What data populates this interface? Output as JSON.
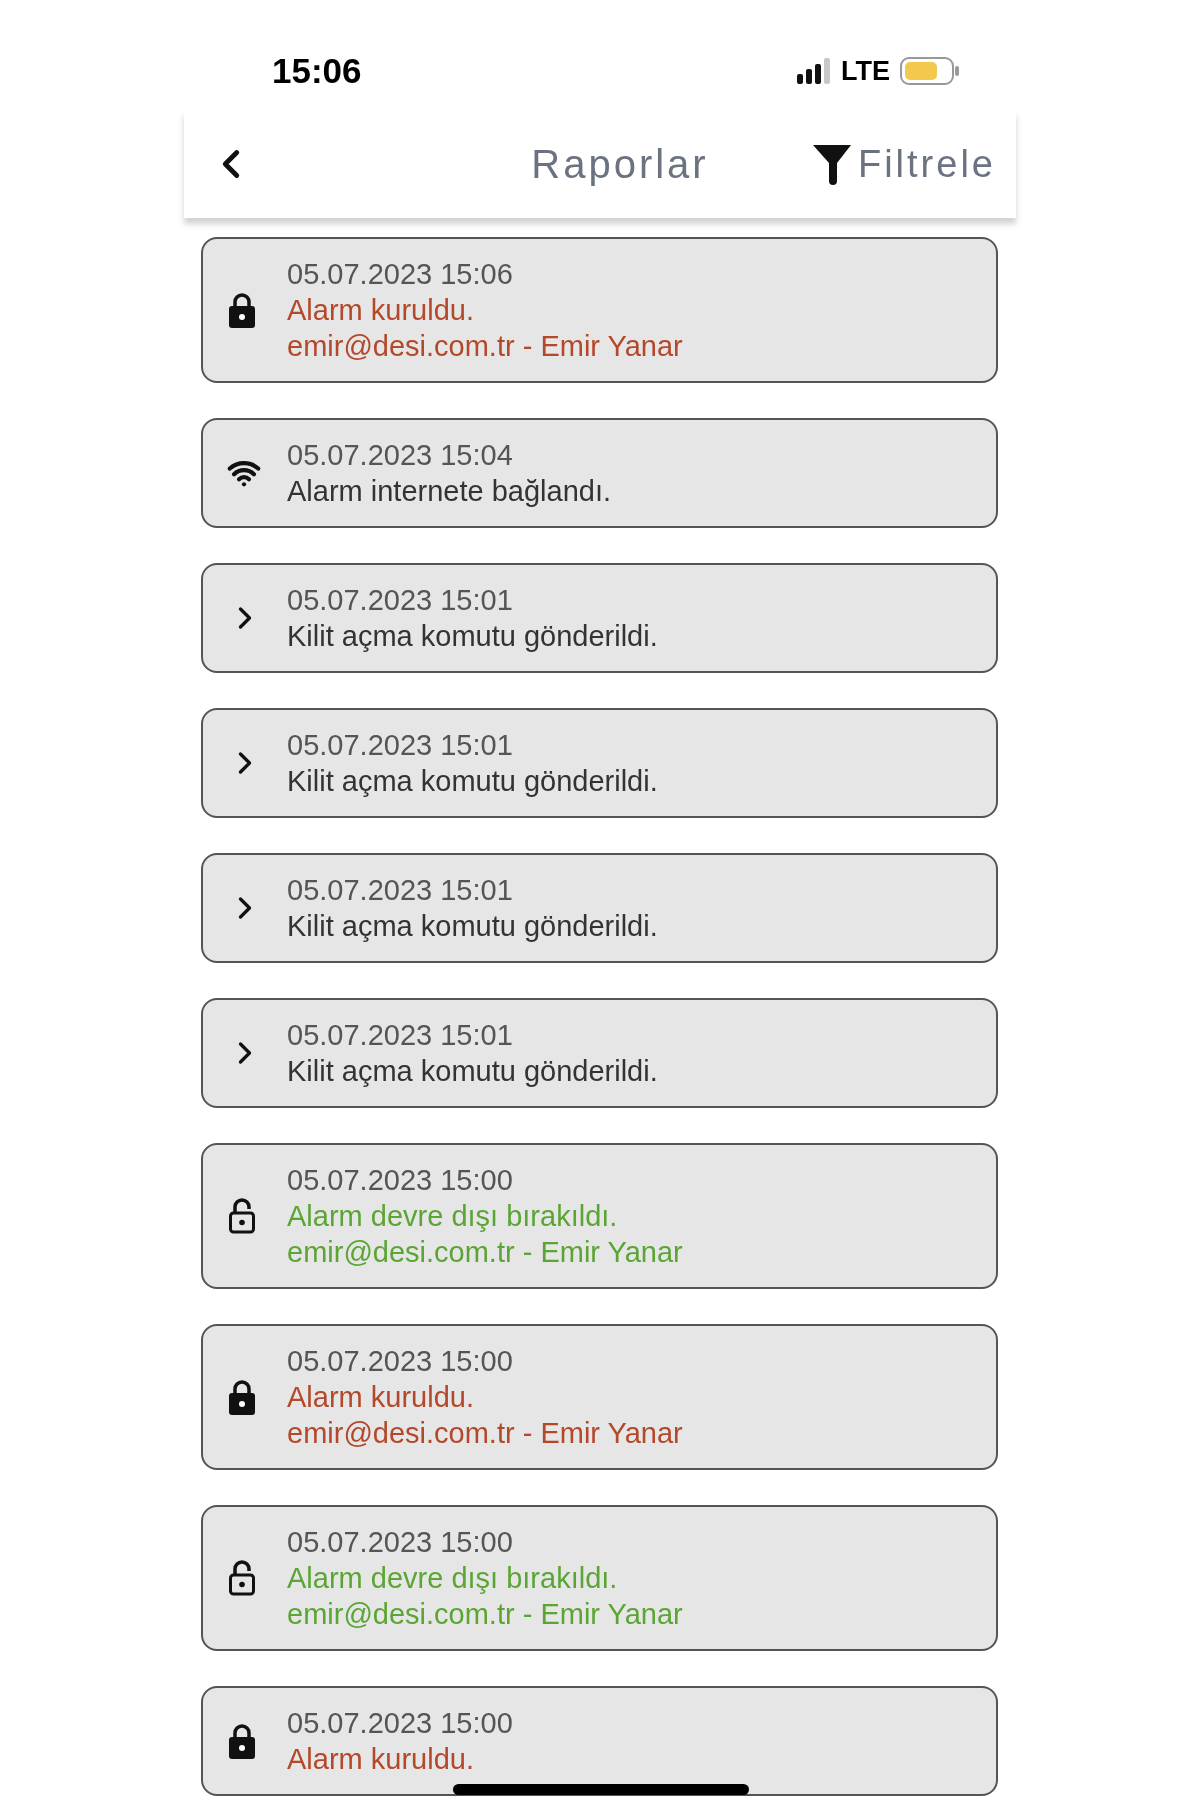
{
  "status_bar": {
    "time": "15:06",
    "network": "LTE"
  },
  "header": {
    "title": "Raporlar",
    "filter": "Filtrele"
  },
  "reports": [
    {
      "kind": "armed",
      "datetime": "05.07.2023 15:06",
      "message": "Alarm kuruldu.",
      "user": "emir@desi.com.tr - Emir Yanar"
    },
    {
      "kind": "connected",
      "datetime": "05.07.2023 15:04",
      "message": "Alarm internete bağlandı."
    },
    {
      "kind": "command",
      "datetime": "05.07.2023 15:01",
      "message": "Kilit açma komutu gönderildi."
    },
    {
      "kind": "command",
      "datetime": "05.07.2023 15:01",
      "message": "Kilit açma komutu gönderildi."
    },
    {
      "kind": "command",
      "datetime": "05.07.2023 15:01",
      "message": "Kilit açma komutu gönderildi."
    },
    {
      "kind": "command",
      "datetime": "05.07.2023 15:01",
      "message": "Kilit açma komutu gönderildi."
    },
    {
      "kind": "disarmed",
      "datetime": "05.07.2023 15:00",
      "message": "Alarm devre dışı bırakıldı.",
      "user": "emir@desi.com.tr - Emir Yanar"
    },
    {
      "kind": "armed",
      "datetime": "05.07.2023 15:00",
      "message": "Alarm kuruldu.",
      "user": "emir@desi.com.tr - Emir Yanar"
    },
    {
      "kind": "disarmed",
      "datetime": "05.07.2023 15:00",
      "message": "Alarm devre dışı bırakıldı.",
      "user": "emir@desi.com.tr - Emir Yanar"
    },
    {
      "kind": "armed",
      "datetime": "05.07.2023 15:00",
      "message": "Alarm kuruldu."
    }
  ]
}
